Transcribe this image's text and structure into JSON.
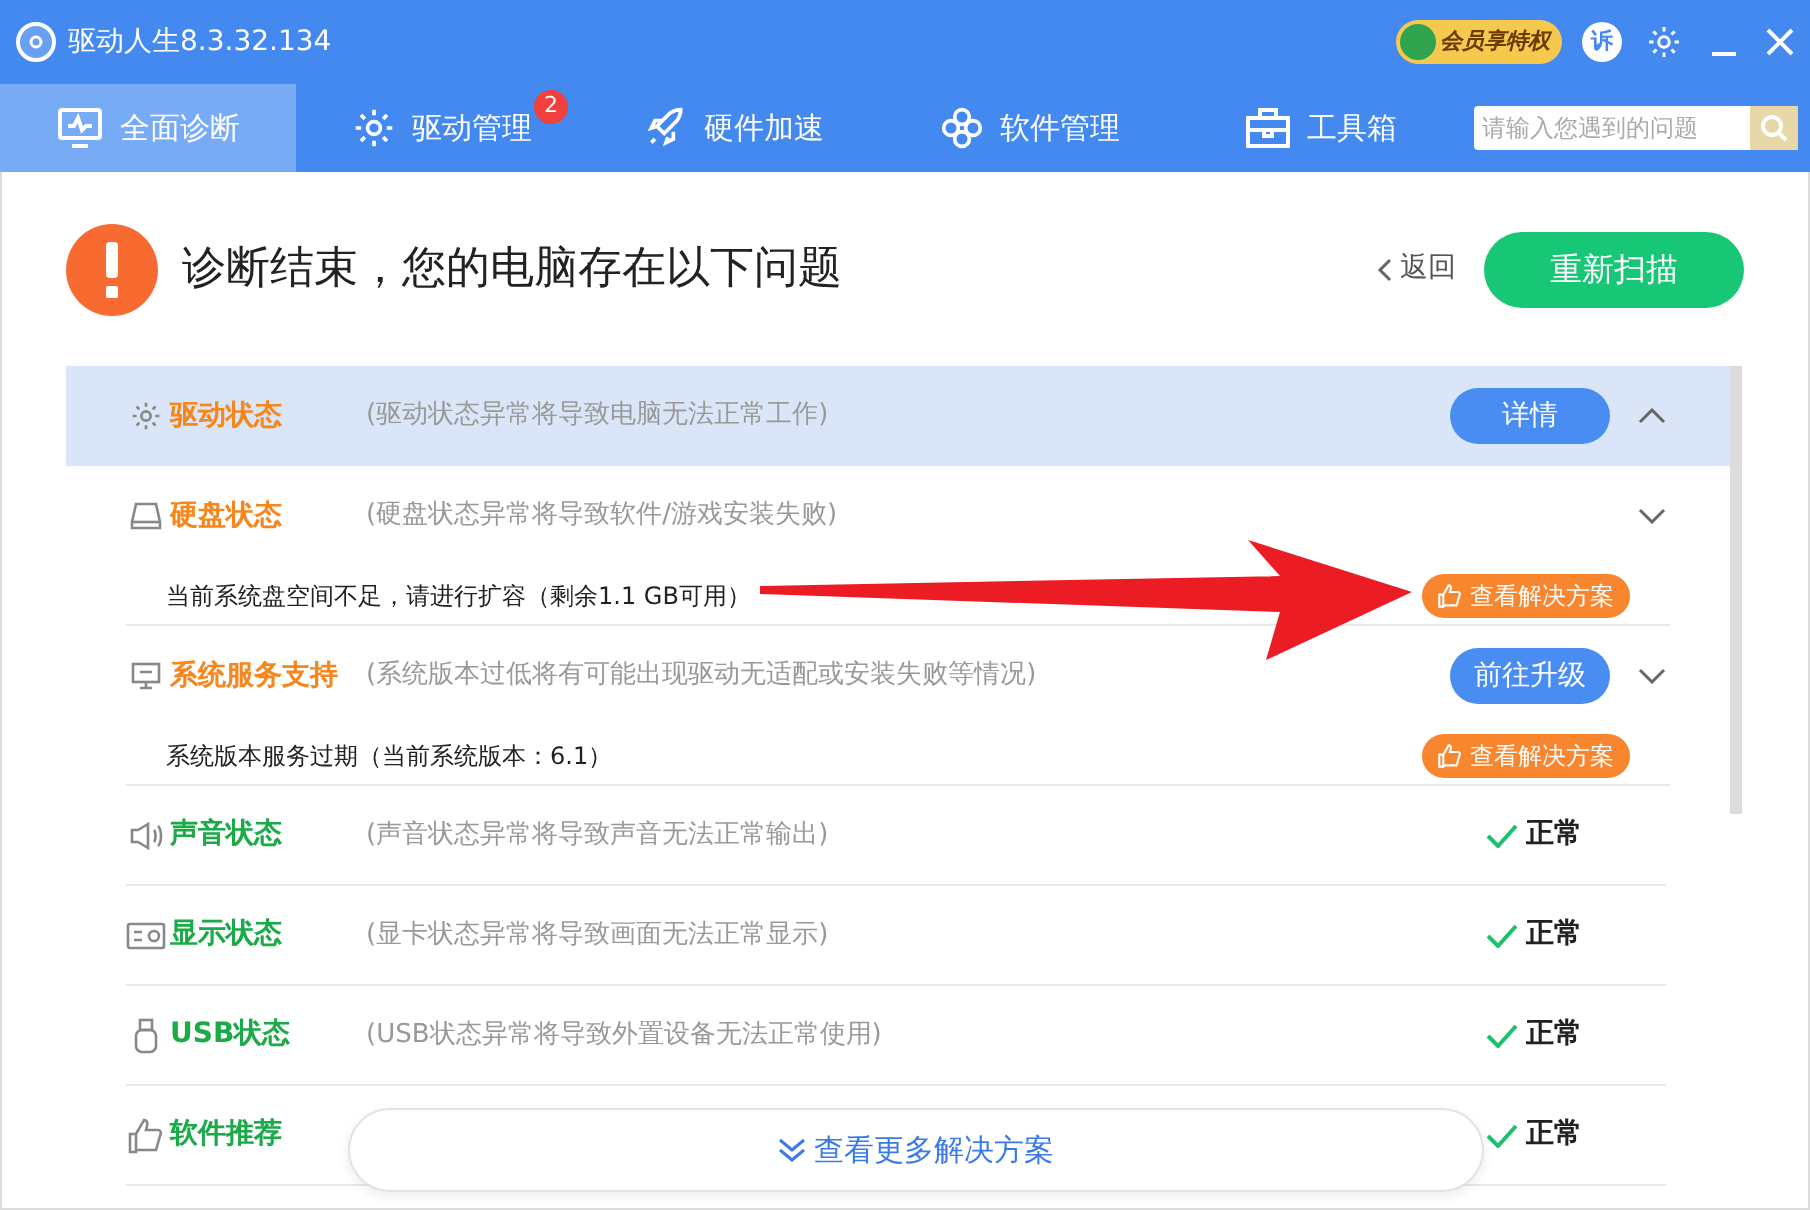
{
  "window": {
    "title": "驱动人生8.3.32.134",
    "vip_badge": "会员享特权",
    "feedback": "诉"
  },
  "tabs": [
    {
      "label": "全面诊断",
      "selected": true
    },
    {
      "label": "驱动管理",
      "selected": false,
      "badge": "2"
    },
    {
      "label": "硬件加速",
      "selected": false
    },
    {
      "label": "软件管理",
      "selected": false
    },
    {
      "label": "工具箱",
      "selected": false
    }
  ],
  "search": {
    "placeholder": "请输入您遇到的问题"
  },
  "header": {
    "title": "诊断结束，您的电脑存在以下问题",
    "back": "返回",
    "rescan": "重新扫描"
  },
  "items": [
    {
      "label": "驱动状态",
      "description": "(驱动状态异常将导致电脑无法正常工作)",
      "problem": true,
      "selected": true,
      "expanded": true,
      "button": "详情"
    },
    {
      "label": "硬盘状态",
      "description": "(硬盘状态异常将导致软件/游戏安装失败)",
      "problem": true,
      "selected": false,
      "expanded": false,
      "detail": "当前系统盘空间不足，请进行扩容（剩余1.1 GB可用）",
      "detail_action": "查看解决方案"
    },
    {
      "label": "系统服务支持",
      "description": "(系统版本过低将有可能出现驱动无适配或安装失败等情况)",
      "problem": true,
      "selected": false,
      "expanded": false,
      "button": "前往升级",
      "detail": "系统版本服务过期（当前系统版本：6.1）",
      "detail_action": "查看解决方案"
    },
    {
      "label": "声音状态",
      "description": "(声音状态异常将导致声音无法正常输出)",
      "problem": false,
      "selected": false,
      "result": "正常"
    },
    {
      "label": "显示状态",
      "description": "(显卡状态异常将导致画面无法正常显示)",
      "problem": false,
      "selected": false,
      "result": "正常"
    },
    {
      "label": "USB状态",
      "description": "(USB状态异常将导致外置设备无法正常使用)",
      "problem": false,
      "selected": false,
      "result": "正常"
    },
    {
      "label": "软件推荐",
      "problem": false,
      "selected": false,
      "result": "正常"
    }
  ],
  "more_button": "查看更多解决方案"
}
